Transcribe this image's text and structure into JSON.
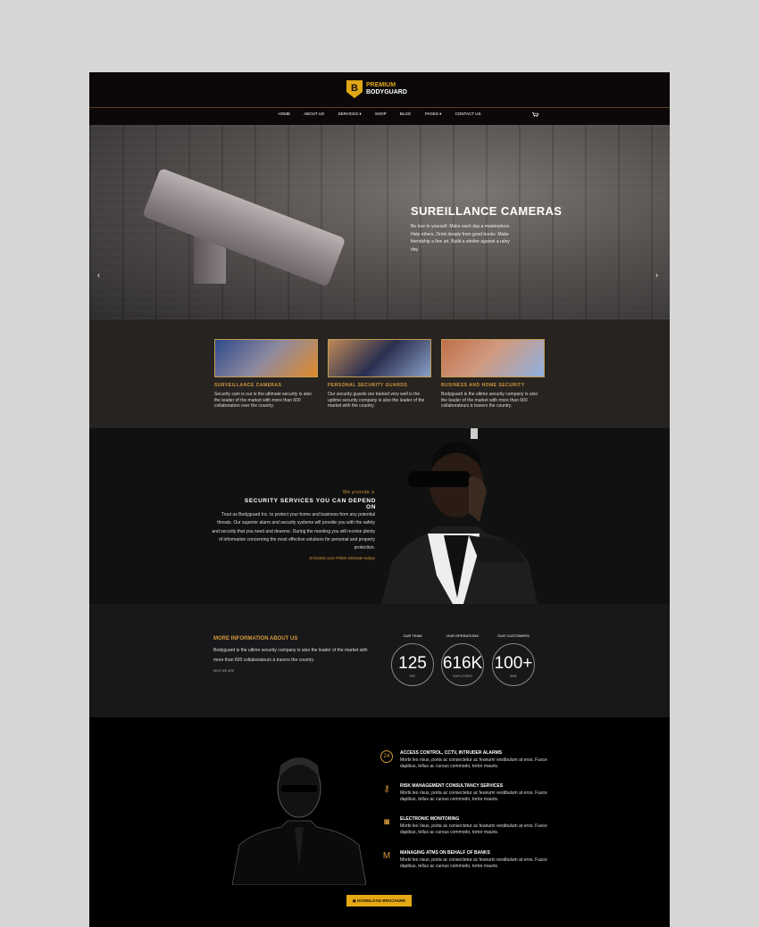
{
  "brand": {
    "logo_letter": "B",
    "line1": "PREMIUM",
    "line2": "BODYGUARD",
    "accent": "#e0a716"
  },
  "nav": {
    "items": [
      "HOME",
      "ABOUT US",
      "SERVICES ▾",
      "SHOP",
      "BLOG",
      "PAGES ▾",
      "CONTACT US"
    ],
    "cart_icon": "cart-icon"
  },
  "hero": {
    "title": "SUREILLANCE CAMERAS",
    "text": "Be true to yourself. Make each day a masterpiece. Help others. Drink deeply from good books. Make friendship a fine art. Build a shelter against a rainy day.",
    "prev": "‹",
    "next": "›"
  },
  "services": [
    {
      "title": "SURVEILLANCE CAMERAS",
      "text": "Security cam is our is the ultimate security is also the leader of the market with more than 600 collaborators over the country."
    },
    {
      "title": "PERSONAL SECURITY GUARDS",
      "text": "Our security guards are trained very well is the uptime security company is also the leader of the market with the country."
    },
    {
      "title": "BUSINESS AND HOME SECURITY",
      "text": "Bodyguard is the ultime security company is also the leader of the market with more than 600 collaborateurs à travers the country."
    }
  ],
  "about": {
    "provide": "We provide a",
    "title": "SECURITY SERVICES YOU CAN DEPEND ON",
    "text": "Trust us Bodyguard Inc. to protect your home and business from any potential threats. Our superior alarm and security systems will provide you with the safety and security that you need and deserve. During the meeting you will receive plenty of information concerning the most effective solutions for personal and property protection.",
    "link": "Schedule your FREE estimate today!"
  },
  "more": {
    "title": "MORE INFORMATION ABOUT US",
    "text": "Bodyguard is the ultime security company is also the leader of the market with more than 600 collaborateurs à travers the country.",
    "link": "WHO WE ARE"
  },
  "stats": [
    {
      "label": "OUR TEAM",
      "value": "125",
      "unit": "PAY"
    },
    {
      "label": "OUR OPERATIONS",
      "value": "616K",
      "unit": "EMPLOYEES"
    },
    {
      "label": "OUR CUSTOMERS",
      "value": "100+",
      "unit": "AWE"
    }
  ],
  "features": [
    {
      "icon": "24",
      "icon_name": "clock-24-icon",
      "title": "ACCESS CONTROL, CCTV, INTRUDER ALARMS",
      "text": "Morbi leo risus, porta ac consectetur ac feanumi vestibulum at eros. Fusce dapibus, tellus ac cursus commodo, tortor mauris."
    },
    {
      "icon": "⚷",
      "icon_name": "key-icon",
      "title": "RISK MANAGEMENT CONSULTANCY SERVICES",
      "text": "Morbi leo risus, porta ac consectetur ac feanumi vestibulum at eros. Fusce dapibus, tellus ac cursus commodo, tortor mauris."
    },
    {
      "icon": "◙",
      "icon_name": "camera-icon",
      "title": "ELECTRONIC MONITORING",
      "text": "Morbi leo risus, porta ac consectetur ac feanumi vestibulum at eros. Fusce dapibus, tellus ac cursus commodo, tortor mauris."
    },
    {
      "icon": "M",
      "icon_name": "atm-icon",
      "title": "MANAGING ATMS ON BEHALF OF BANKS",
      "text": "Morbi leo risus, porta ac consectetur ac feanumi vestibulum at eros. Fusce dapibus, tellus ac cursus commodo, tortor mauris."
    }
  ],
  "download": {
    "label": "◉ DOWNLOAD BROCHURE"
  }
}
